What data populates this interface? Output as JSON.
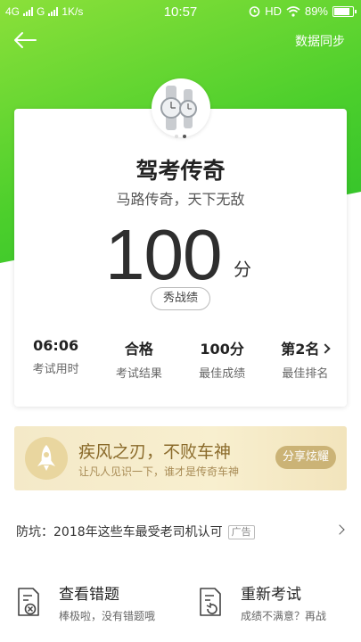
{
  "status_bar": {
    "network_left": "4G",
    "network_right": "G",
    "speed": "1K/s",
    "time": "10:57",
    "hd": "HD",
    "battery": "89%",
    "battery_level": 0.89
  },
  "header": {
    "sync_label": "数据同步"
  },
  "result": {
    "title": "驾考传奇",
    "subtitle": "马路传奇，天下无敌",
    "score": "100",
    "score_unit": "分",
    "share_chip": "秀战绩",
    "stats": [
      {
        "value": "06:06",
        "label": "考试用时"
      },
      {
        "value": "合格",
        "label": "考试结果"
      },
      {
        "value": "100分",
        "label": "最佳成绩"
      },
      {
        "value": "第2名",
        "label": "最佳排名"
      }
    ]
  },
  "banner": {
    "title": "疾风之刃，不败车神",
    "subtitle": "让凡人见识一下，谁才是传奇车神",
    "button": "分享炫耀"
  },
  "ad": {
    "text": "防坑：2018年这些车最受老司机认可",
    "tag": "广告"
  },
  "actions": [
    {
      "title": "查看错题",
      "subtitle": "棒极啦，没有错题哦"
    },
    {
      "title": "重新考试",
      "subtitle": "成绩不满意？再战"
    }
  ],
  "colors": {
    "hero_green": "#4ccf2c",
    "banner_gold": "#cbb376"
  }
}
